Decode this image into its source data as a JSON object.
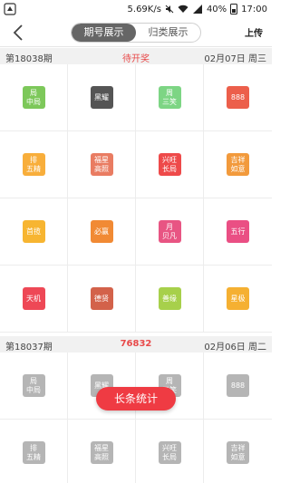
{
  "status_bar": {
    "speed": "5.69K/s",
    "battery": "40%",
    "time": "17:00"
  },
  "nav": {
    "tab_active": "期号展示",
    "tab_inactive": "归类展示",
    "upload": "上传"
  },
  "section1": {
    "period": "第18038期",
    "status": "待开奖",
    "date": "02月07日",
    "weekday": "周三",
    "tiles": [
      {
        "text": "局\n中局",
        "color": "#7dc85a"
      },
      {
        "text": "黑耀",
        "color": "#555555"
      },
      {
        "text": "周\n三笑",
        "color": "#7dd584"
      },
      {
        "text": "888",
        "color": "#ec5f4b"
      },
      {
        "text": "排\n五精",
        "color": "#f8ae3b"
      },
      {
        "text": "福星\n高照",
        "color": "#e97c62"
      },
      {
        "text": "兴旺\n长局",
        "color": "#ee4a4a"
      },
      {
        "text": "吉祥\n如意",
        "color": "#f29a3c"
      },
      {
        "text": "首揽",
        "color": "#f7b531"
      },
      {
        "text": "必赢",
        "color": "#f18a34"
      },
      {
        "text": "月\n贝凡",
        "color": "#e85583"
      },
      {
        "text": "五行",
        "color": "#ea4f84"
      },
      {
        "text": "天机",
        "color": "#ee4856"
      },
      {
        "text": "德贤",
        "color": "#d3624a"
      },
      {
        "text": "善缘",
        "color": "#a7d04b"
      },
      {
        "text": "星极",
        "color": "#f5b032"
      }
    ]
  },
  "section2": {
    "period": "第18037期",
    "number": "76832",
    "date": "02月06日",
    "weekday": "周二",
    "tiles": [
      {
        "text": "局\n中局",
        "color": "#b5b5b5"
      },
      {
        "text": "黑耀",
        "color": "#b5b5b5"
      },
      {
        "text": "周\n三笑",
        "color": "#b5b5b5"
      },
      {
        "text": "888",
        "color": "#b5b5b5"
      },
      {
        "text": "排\n五精",
        "color": "#b5b5b5"
      },
      {
        "text": "福星\n高照",
        "color": "#b5b5b5"
      },
      {
        "text": "兴旺\n长局",
        "color": "#b5b5b5"
      },
      {
        "text": "吉祥\n如意",
        "color": "#b5b5b5"
      }
    ]
  },
  "float_button": "长条统计"
}
